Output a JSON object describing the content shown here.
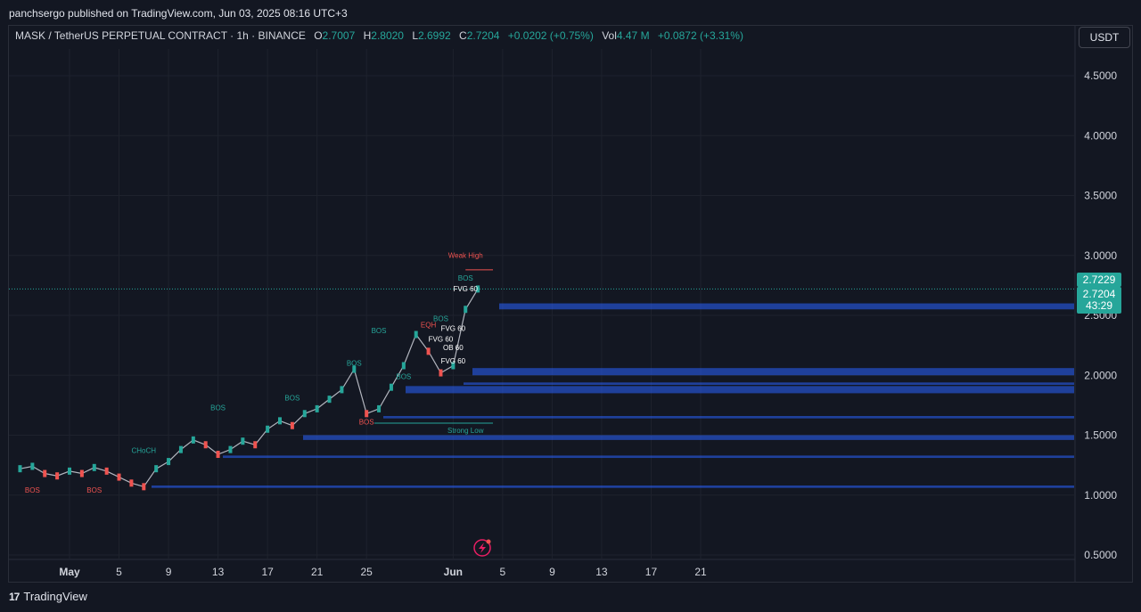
{
  "header": {
    "publish_text": "panchsergo published on TradingView.com, Jun 03, 2025 08:16 UTC+3"
  },
  "legend": {
    "symbol": "MASK / TetherUS PERPETUAL CONTRACT · 1h · BINANCE",
    "open_label": "O",
    "open": "2.7007",
    "high_label": "H",
    "high": "2.8020",
    "low_label": "L",
    "low": "2.6992",
    "close_label": "C",
    "close": "2.7204",
    "change": "+0.0202 (+0.75%)",
    "vol_label": "Vol",
    "volume": "4.47 M",
    "vol_change": "+0.0872 (+3.31%)"
  },
  "currency_button": "USDT",
  "footer": {
    "brand": "TradingView",
    "logo": "17"
  },
  "colors": {
    "background": "#131722",
    "bull": "#26a69a",
    "bear": "#ef5350",
    "zone": "#2962ff",
    "grid": "#1e222d"
  },
  "icons": {
    "flash": "lightning-icon"
  },
  "chart_data": {
    "type": "line",
    "title": "MASK / TetherUS PERPETUAL CONTRACT · 1h · BINANCE",
    "ylim": [
      0.5,
      4.75
    ],
    "y_ticks": [
      "4.5000",
      "4.0000",
      "3.5000",
      "3.0000",
      "2.5000",
      "2.0000",
      "1.5000",
      "1.0000",
      "0.5000"
    ],
    "y_tick_values": [
      4.5,
      4.0,
      3.5,
      3.0,
      2.5,
      2.0,
      1.5,
      1.0,
      0.5
    ],
    "x_ticks": [
      "May",
      "5",
      "9",
      "13",
      "17",
      "21",
      "25",
      "Jun",
      "5",
      "9",
      "13",
      "17",
      "21"
    ],
    "x_tick_dates": [
      "2025-05-01",
      "2025-05-05",
      "2025-05-09",
      "2025-05-13",
      "2025-05-17",
      "2025-05-21",
      "2025-05-25",
      "2025-06-01",
      "2025-06-05",
      "2025-06-09",
      "2025-06-13",
      "2025-06-17",
      "2025-06-21"
    ],
    "grid": true,
    "price_labels": [
      {
        "text": "2.7229",
        "value": 2.7229
      },
      {
        "text": "2.7204",
        "value": 2.7204
      },
      {
        "text": "43:29",
        "value": 2.7204
      }
    ],
    "series": [
      {
        "dates": [
          "2025-04-27",
          "2025-04-28",
          "2025-04-29",
          "2025-04-30",
          "2025-05-01",
          "2025-05-02",
          "2025-05-03",
          "2025-05-04",
          "2025-05-05",
          "2025-05-06",
          "2025-05-07",
          "2025-05-08",
          "2025-05-09",
          "2025-05-10",
          "2025-05-11",
          "2025-05-12",
          "2025-05-13",
          "2025-05-14",
          "2025-05-15",
          "2025-05-16",
          "2025-05-17",
          "2025-05-18",
          "2025-05-19",
          "2025-05-20",
          "2025-05-21",
          "2025-05-22",
          "2025-05-23",
          "2025-05-24",
          "2025-05-25",
          "2025-05-26",
          "2025-05-27",
          "2025-05-28",
          "2025-05-29",
          "2025-05-30",
          "2025-05-31",
          "2025-06-01",
          "2025-06-02",
          "2025-06-03"
        ],
        "values": [
          1.22,
          1.24,
          1.18,
          1.16,
          1.2,
          1.18,
          1.23,
          1.2,
          1.15,
          1.1,
          1.07,
          1.22,
          1.28,
          1.38,
          1.46,
          1.42,
          1.34,
          1.38,
          1.45,
          1.42,
          1.55,
          1.62,
          1.58,
          1.68,
          1.72,
          1.8,
          1.88,
          2.05,
          1.68,
          1.72,
          1.9,
          2.08,
          2.34,
          2.2,
          2.02,
          2.08,
          2.55,
          2.72
        ]
      }
    ],
    "zones": [
      {
        "y0": 2.55,
        "y1": 2.6
      },
      {
        "y0": 2.0,
        "y1": 2.06
      },
      {
        "y0": 1.85,
        "y1": 1.91
      },
      {
        "y0": 1.92,
        "y1": 1.94
      },
      {
        "y0": 1.64,
        "y1": 1.66
      },
      {
        "y0": 1.46,
        "y1": 1.5
      },
      {
        "y0": 1.31,
        "y1": 1.33
      },
      {
        "y0": 1.06,
        "y1": 1.08
      }
    ],
    "annotations": [
      {
        "text": "Weak High",
        "x": "2025-06-02",
        "y": 2.98,
        "color": "bear"
      },
      {
        "text": "Strong Low",
        "x": "2025-06-02",
        "y": 1.52,
        "color": "bull"
      },
      {
        "text": "BOS",
        "x": "2025-05-26",
        "y": 2.35,
        "color": "bull"
      },
      {
        "text": "BOS",
        "x": "2025-05-31",
        "y": 2.45,
        "color": "bull"
      },
      {
        "text": "EQH",
        "x": "2025-05-30",
        "y": 2.4,
        "color": "bear"
      },
      {
        "text": "BOS",
        "x": "2025-05-13",
        "y": 1.71,
        "color": "bull"
      },
      {
        "text": "BOS",
        "x": "2025-05-19",
        "y": 1.79,
        "color": "bull"
      },
      {
        "text": "BOS",
        "x": "2025-05-24",
        "y": 2.08,
        "color": "bull"
      },
      {
        "text": "BOS",
        "x": "2025-05-28",
        "y": 1.97,
        "color": "bull"
      },
      {
        "text": "CHoCH",
        "x": "2025-05-07",
        "y": 1.35,
        "color": "bull"
      },
      {
        "text": "BOS",
        "x": "2025-04-28",
        "y": 1.02,
        "color": "bear"
      },
      {
        "text": "BOS",
        "x": "2025-05-03",
        "y": 1.02,
        "color": "bear"
      },
      {
        "text": "BOS",
        "x": "2025-05-25",
        "y": 1.59,
        "color": "bear"
      },
      {
        "text": "BOS",
        "x": "2025-06-02",
        "y": 2.79,
        "color": "bull"
      },
      {
        "text": "FVG 60",
        "x": "2025-06-01",
        "y": 2.37,
        "color": "white"
      },
      {
        "text": "FVG 60",
        "x": "2025-05-31",
        "y": 2.28,
        "color": "white"
      },
      {
        "text": "OB 60",
        "x": "2025-06-01",
        "y": 2.21,
        "color": "white"
      },
      {
        "text": "FVG 60",
        "x": "2025-06-01",
        "y": 2.1,
        "color": "white"
      },
      {
        "text": "FVG 60",
        "x": "2025-06-02",
        "y": 2.7,
        "color": "white"
      }
    ]
  }
}
